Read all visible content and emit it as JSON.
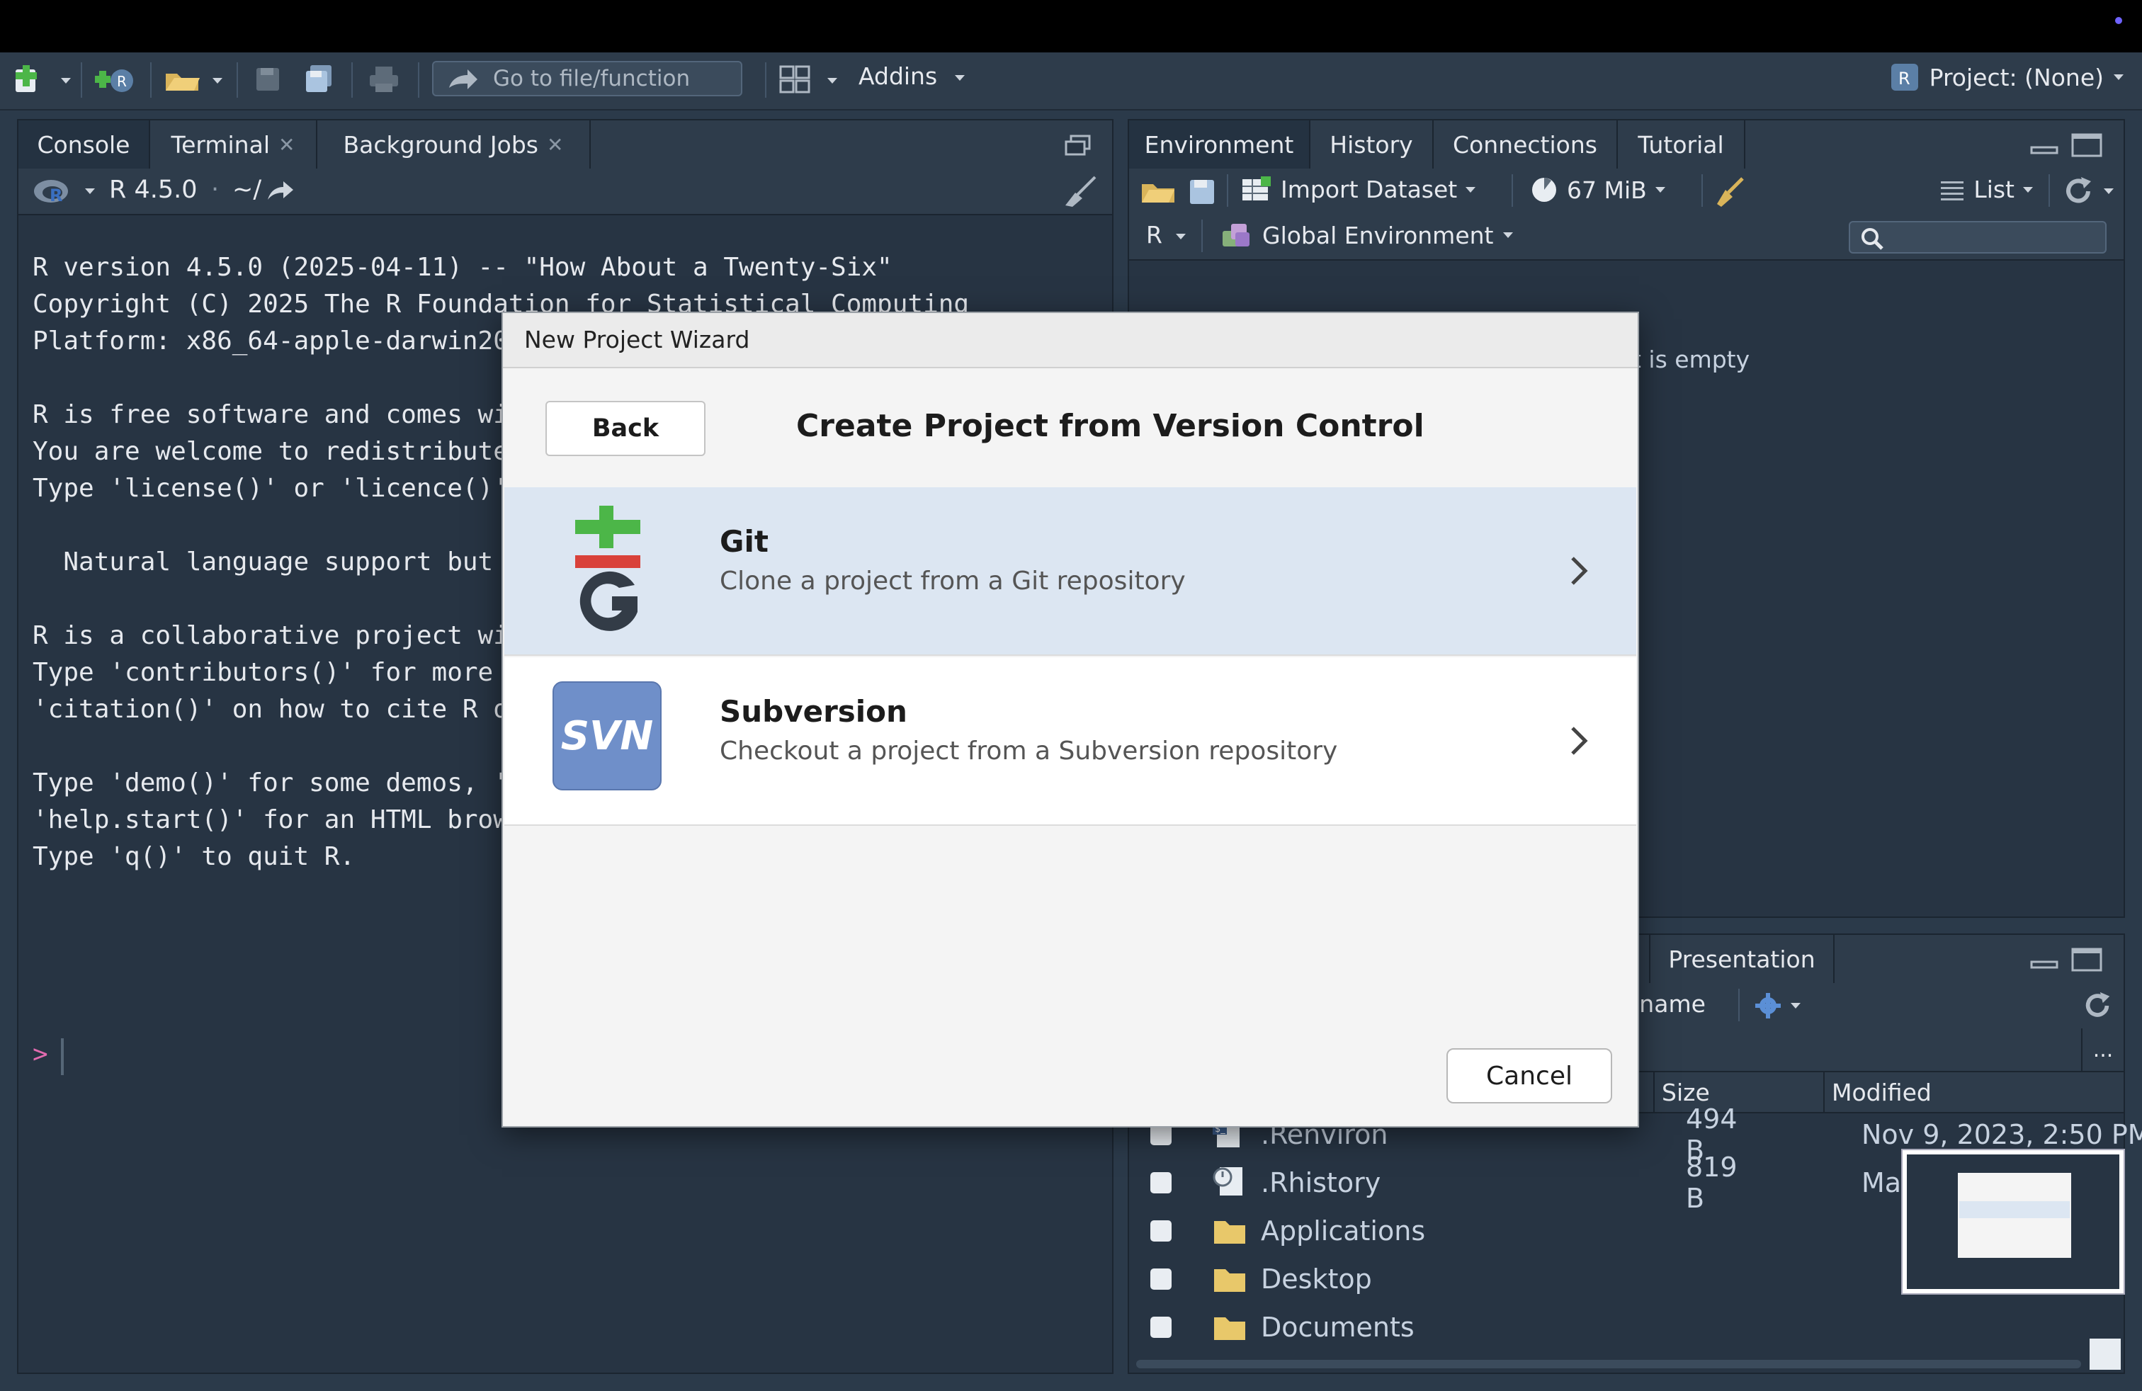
{
  "toolbar": {
    "goto_placeholder": "Go to file/function",
    "addins_label": "Addins",
    "project_label": "Project: (None)"
  },
  "console": {
    "tabs": [
      "Console",
      "Terminal",
      "Background Jobs"
    ],
    "r_version_label": "R 4.5.0",
    "path": "~/",
    "lines": [
      "R version 4.5.0 (2025-04-11) -- \"How About a Twenty-Six\"",
      "Copyright (C) 2025 The R Foundation for Statistical Computing",
      "Platform: x86_64-apple-darwin20",
      "",
      "R is free software and comes wi",
      "You are welcome to redistribute",
      "Type 'license()' or 'licence()'",
      "",
      "  Natural language support but",
      "",
      "R is a collaborative project wi",
      "Type 'contributors()' for more",
      "'citation()' on how to cite R o",
      "",
      "Type 'demo()' for some demos, '",
      "'help.start()' for an HTML brow",
      "Type 'q()' to quit R."
    ],
    "prompt": ">"
  },
  "environment": {
    "tabs": [
      "Environment",
      "History",
      "Connections",
      "Tutorial"
    ],
    "import_label": "Import Dataset",
    "memory_label": "67 MiB",
    "view_label": "List",
    "lang_label": "R",
    "scope_label": "Global Environment",
    "empty_text": "t is empty"
  },
  "files": {
    "visible_tab_fragment": "r",
    "presentation_tab": "Presentation",
    "rename_fragment": "ename",
    "more_label": "...",
    "col_size": "Size",
    "col_modified": "Modified",
    "rows": [
      {
        "name": ".Renviron",
        "size": "494 B",
        "modified": "Nov 9, 2023, 2:50 PM"
      },
      {
        "name": ".Rhistory",
        "size": "819 B",
        "modified": "Ma"
      },
      {
        "name": "Applications",
        "size": "",
        "modified": ""
      },
      {
        "name": "Desktop",
        "size": "",
        "modified": ""
      },
      {
        "name": "Documents",
        "size": "",
        "modified": ""
      }
    ]
  },
  "modal": {
    "title": "New Project Wizard",
    "back_label": "Back",
    "heading": "Create Project from Version Control",
    "options": [
      {
        "title": "Git",
        "description": "Clone a project from a Git repository"
      },
      {
        "title": "Subversion",
        "description": "Checkout a project from a Subversion repository"
      }
    ],
    "svn_badge": "SVN",
    "cancel_label": "Cancel"
  },
  "colors": {
    "git_plus": "#4cb648",
    "git_minus": "#d9413a",
    "svn_badge": "#6f8fc9",
    "selected_row": "#dce6f2",
    "prompt": "#e36bb0"
  }
}
